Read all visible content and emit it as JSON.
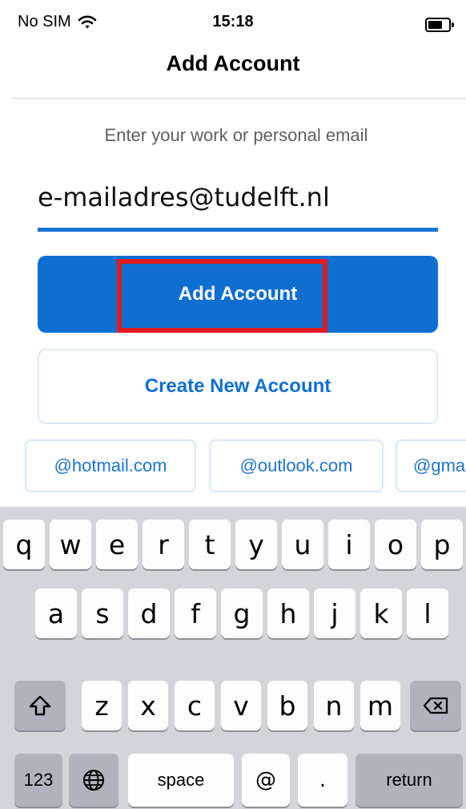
{
  "status_bar": {
    "carrier": "No SIM",
    "time": "15:18"
  },
  "header": {
    "title": "Add Account"
  },
  "form": {
    "prompt": "Enter your work or personal email",
    "email_value": "e-mailadres@tudelft.nl",
    "add_button_label": "Add Account",
    "create_button_label": "Create New Account"
  },
  "suggestions": [
    "@hotmail.com",
    "@outlook.com",
    "@gmail.com"
  ],
  "keyboard": {
    "row1": [
      "q",
      "w",
      "e",
      "r",
      "t",
      "y",
      "u",
      "i",
      "o",
      "p"
    ],
    "row2": [
      "a",
      "s",
      "d",
      "f",
      "g",
      "h",
      "j",
      "k",
      "l"
    ],
    "row3": [
      "z",
      "x",
      "c",
      "v",
      "b",
      "n",
      "m"
    ],
    "numbers_label": "123",
    "space_label": "space",
    "at_label": "@",
    "dot_label": ".",
    "return_label": "return"
  },
  "colors": {
    "accent": "#0f6fd1",
    "highlight": "#e01a23",
    "keyboard_bg": "#d3d5da"
  }
}
